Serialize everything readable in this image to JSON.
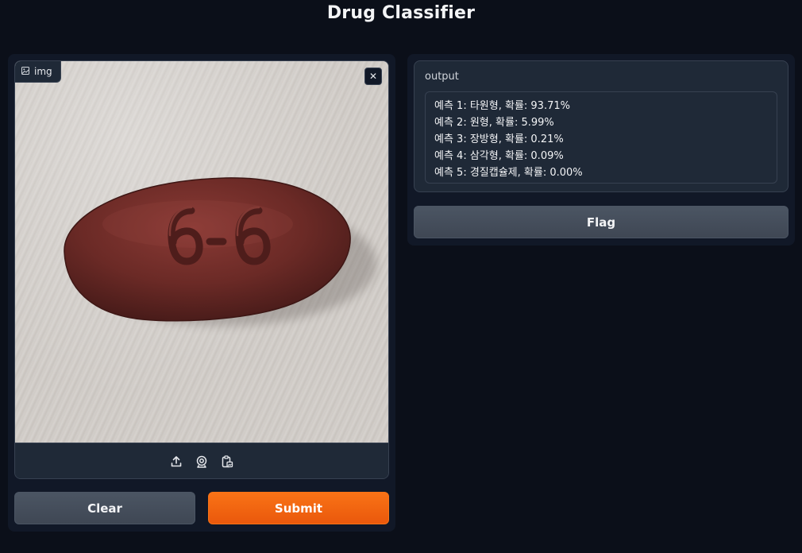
{
  "app": {
    "title": "Drug Classifier"
  },
  "input": {
    "label": "img",
    "image_icon": "image-icon",
    "close_icon": "close-icon",
    "sources": [
      "upload-icon",
      "webcam-icon",
      "clipboard-icon"
    ],
    "pill_imprint": "6-6"
  },
  "buttons": {
    "clear": "Clear",
    "submit": "Submit",
    "flag": "Flag"
  },
  "output": {
    "label": "output",
    "lines": [
      "예측 1: 타원형, 확률: 93.71%",
      "예측 2: 원형, 확률: 5.99%",
      "예측 3: 장방형, 확률: 0.21%",
      "예측 4: 삼각형, 확률: 0.09%",
      "예측 5: 경질캡슐제, 확률: 0.00%"
    ]
  },
  "colors": {
    "background": "#0b0f19",
    "panel": "#111827",
    "block": "#1f2937",
    "border": "#374151",
    "primary": "#f97316",
    "secondary": "#4b5563",
    "pill": "#6b2a26"
  }
}
